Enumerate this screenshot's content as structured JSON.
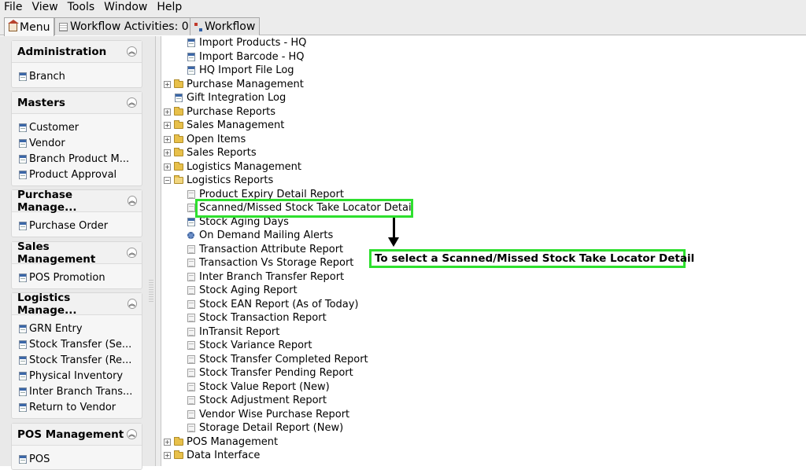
{
  "menubar": [
    "File",
    "View",
    "Tools",
    "Window",
    "Help"
  ],
  "tabs": [
    {
      "label": "Menu",
      "icon": "home-icon"
    },
    {
      "label": "Workflow Activities: 0",
      "icon": "table-icon"
    },
    {
      "label": "Workflow",
      "icon": "workflow-icon"
    }
  ],
  "sidebar": {
    "sections": [
      {
        "title": "Administration",
        "items": [
          "Branch"
        ]
      },
      {
        "title": "Masters",
        "items": [
          "Customer",
          "Vendor",
          "Branch Product M...",
          "Product Approval"
        ]
      },
      {
        "title": "Purchase Manage...",
        "items": [
          "Purchase Order"
        ]
      },
      {
        "title": "Sales Management",
        "items": [
          "POS Promotion"
        ]
      },
      {
        "title": "Logistics Manage...",
        "items": [
          "GRN Entry",
          "Stock Transfer (Se...",
          "Stock Transfer (Re...",
          "Physical Inventory",
          "Inter Branch Trans...",
          "Return to Vendor"
        ]
      },
      {
        "title": "POS Management",
        "items": [
          "POS"
        ]
      }
    ]
  },
  "tree": {
    "nodes": [
      {
        "label": "Import Products - HQ",
        "type": "leaf-blue",
        "level": 2
      },
      {
        "label": "Import Barcode - HQ",
        "type": "leaf-blue",
        "level": 2
      },
      {
        "label": "HQ Import File Log",
        "type": "leaf-blue",
        "level": 2
      },
      {
        "label": "Purchase Management",
        "type": "folder",
        "level": 1
      },
      {
        "label": "Gift Integration Log",
        "type": "leaf-blue",
        "level": 1
      },
      {
        "label": "Purchase Reports",
        "type": "folder",
        "level": 1
      },
      {
        "label": "Sales Management",
        "type": "folder",
        "level": 1
      },
      {
        "label": "Open Items",
        "type": "folder",
        "level": 1
      },
      {
        "label": "Sales Reports",
        "type": "folder",
        "level": 1
      },
      {
        "label": "Logistics Management",
        "type": "folder",
        "level": 1
      },
      {
        "label": "Logistics Reports",
        "type": "folder-open",
        "level": 1
      },
      {
        "label": "Product Expiry Detail Report",
        "type": "leaf-gray",
        "level": 2
      },
      {
        "label": "Scanned/Missed Stock Take Locator Detail",
        "type": "leaf-gray",
        "level": 2
      },
      {
        "label": "Stock Aging Days",
        "type": "leaf-blue",
        "level": 2
      },
      {
        "label": "On Demand Mailing Alerts",
        "type": "gear",
        "level": 2
      },
      {
        "label": "Transaction Attribute Report",
        "type": "leaf-gray",
        "level": 2
      },
      {
        "label": "Transaction Vs Storage Report",
        "type": "leaf-gray",
        "level": 2
      },
      {
        "label": "Inter Branch Transfer Report",
        "type": "leaf-gray",
        "level": 2
      },
      {
        "label": "Stock Aging Report",
        "type": "leaf-gray",
        "level": 2
      },
      {
        "label": "Stock EAN Report (As of Today)",
        "type": "leaf-gray",
        "level": 2
      },
      {
        "label": "Stock Transaction Report",
        "type": "leaf-gray",
        "level": 2
      },
      {
        "label": "InTransit Report",
        "type": "leaf-gray",
        "level": 2
      },
      {
        "label": "Stock Variance Report",
        "type": "leaf-gray",
        "level": 2
      },
      {
        "label": "Stock Transfer Completed Report",
        "type": "leaf-gray",
        "level": 2
      },
      {
        "label": "Stock Transfer Pending Report",
        "type": "leaf-gray",
        "level": 2
      },
      {
        "label": "Stock Value Report (New)",
        "type": "leaf-gray",
        "level": 2
      },
      {
        "label": "Stock Adjustment Report",
        "type": "leaf-gray",
        "level": 2
      },
      {
        "label": "Vendor Wise Purchase Report",
        "type": "leaf-gray",
        "level": 2
      },
      {
        "label": "Storage Detail Report (New)",
        "type": "leaf-gray",
        "level": 2
      },
      {
        "label": "POS Management",
        "type": "folder",
        "level": 1
      },
      {
        "label": "Data Interface",
        "type": "folder",
        "level": 1
      }
    ]
  },
  "annotation": {
    "callout": "To select a Scanned/Missed Stock Take Locator Detail",
    "highlight_color": "#2ee02e"
  }
}
